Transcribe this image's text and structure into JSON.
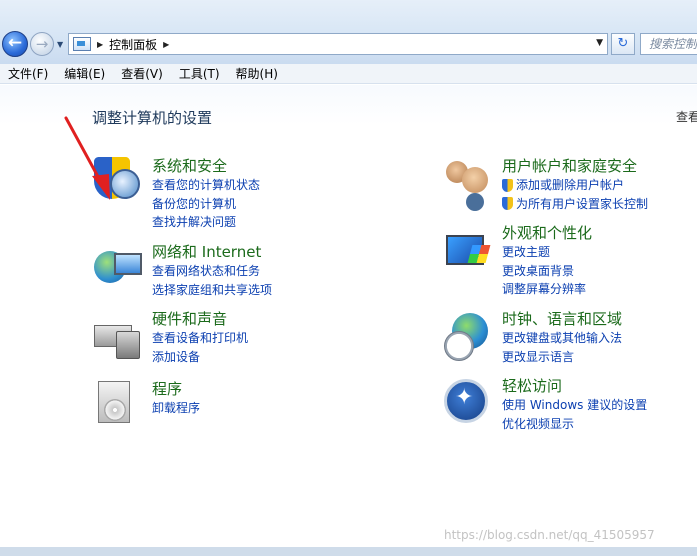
{
  "address_bar": {
    "breadcrumb": "控制面板",
    "search_placeholder": "搜索控制"
  },
  "menu": [
    "文件(F)",
    "编辑(E)",
    "查看(V)",
    "工具(T)",
    "帮助(H)"
  ],
  "page": {
    "title": "调整计算机的设置",
    "view_by": "查看"
  },
  "categories": [
    {
      "title": "系统和安全",
      "icon": "shield-computer-icon",
      "links": [
        "查看您的计算机状态",
        "备份您的计算机",
        "查找并解决问题"
      ]
    },
    {
      "title": "网络和 Internet",
      "icon": "network-globe-icon",
      "links": [
        "查看网络状态和任务",
        "选择家庭组和共享选项"
      ]
    },
    {
      "title": "硬件和声音",
      "icon": "printer-icon",
      "links": [
        "查看设备和打印机",
        "添加设备"
      ]
    },
    {
      "title": "程序",
      "icon": "programs-icon",
      "links": [
        "卸载程序"
      ]
    },
    {
      "title": "用户帐户和家庭安全",
      "icon": "users-icon",
      "links": [
        "添加或删除用户帐户",
        "为所有用户设置家长控制"
      ]
    },
    {
      "title": "外观和个性化",
      "icon": "display-icon",
      "links": [
        "更改主题",
        "更改桌面背景",
        "调整屏幕分辨率"
      ]
    },
    {
      "title": "时钟、语言和区域",
      "icon": "clock-globe-icon",
      "links": [
        "更改键盘或其他输入法",
        "更改显示语言"
      ]
    },
    {
      "title": "轻松访问",
      "icon": "accessibility-icon",
      "links": [
        "使用 Windows 建议的设置",
        "优化视频显示"
      ]
    }
  ],
  "watermark": "https://blog.csdn.net/qq_41505957",
  "colors": {
    "category_title": "#1b6a1b",
    "link": "#0b3fb0",
    "annotation_arrow": "#e02020"
  }
}
